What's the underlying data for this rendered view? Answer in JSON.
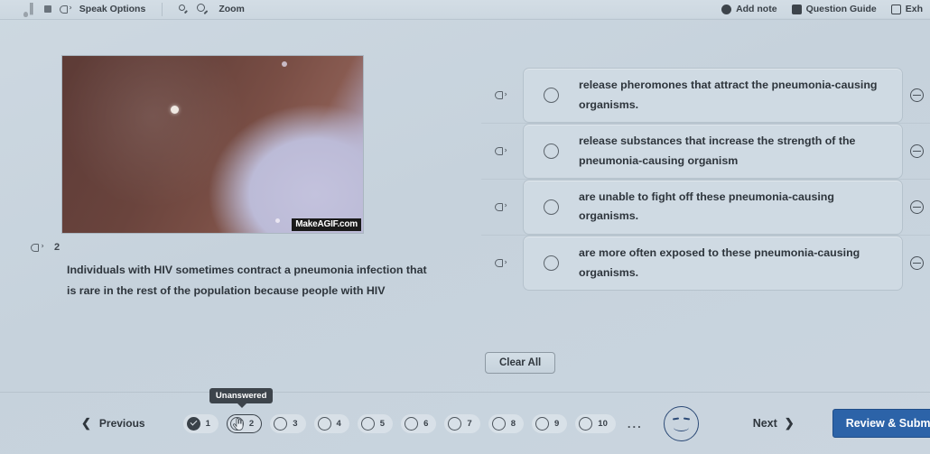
{
  "toolbar": {
    "left_items": [
      {
        "icon": "reader-avatar-icon",
        "label": ""
      },
      {
        "icon": "pause-icon",
        "label": ""
      },
      {
        "icon": "stop-icon",
        "label": ""
      },
      {
        "icon": "speaker-icon",
        "label": "Speak Options"
      }
    ],
    "speak_options_label": "Speak Options",
    "zoom_label": "Zoom",
    "right_items": [
      {
        "icon": "add-note-icon",
        "label": "Add note"
      },
      {
        "icon": "question-guide-icon",
        "label": "Question Guide"
      },
      {
        "icon": "exhibit-icon",
        "label": "Exh"
      }
    ],
    "add_note_label": "Add note",
    "question_guide_label": "Question Guide",
    "exhibit_label": "Exh"
  },
  "stimulus": {
    "watermark": "MakeAGIF.com",
    "alt": "microscopy animation of a pale lavender cell against dark reddish-brown tissue"
  },
  "question": {
    "number": "2",
    "text": "Individuals with HIV sometimes contract a pneumonia infection that is rare in the rest of the population because people with HIV"
  },
  "options": [
    {
      "id": "A",
      "text": "release pheromones that attract the pneumonia-causing organisms.",
      "selected": false
    },
    {
      "id": "B",
      "text": "release substances that increase the strength of the pneumonia-causing organism",
      "selected": false
    },
    {
      "id": "C",
      "text": "are unable to fight off these pneumonia-causing organisms.",
      "selected": false
    },
    {
      "id": "D",
      "text": "are more often exposed to these pneumonia-causing organisms.",
      "selected": false
    }
  ],
  "actions": {
    "clear_all_label": "Clear All"
  },
  "navigation": {
    "previous_label": "Previous",
    "next_label": "Next",
    "submit_label": "Review & Submit",
    "tooltip_label": "Unanswered",
    "ellipsis": "...",
    "items": [
      {
        "number": "1",
        "state": "answered"
      },
      {
        "number": "2",
        "state": "current"
      },
      {
        "number": "3",
        "state": "unanswered"
      },
      {
        "number": "4",
        "state": "unanswered"
      },
      {
        "number": "5",
        "state": "unanswered"
      },
      {
        "number": "6",
        "state": "unanswered"
      },
      {
        "number": "7",
        "state": "unanswered"
      },
      {
        "number": "8",
        "state": "unanswered"
      },
      {
        "number": "9",
        "state": "unanswered"
      },
      {
        "number": "10",
        "state": "unanswered"
      }
    ]
  },
  "colors": {
    "page_bg": "#c8d4de",
    "card_bg": "#cfdae3",
    "submit_blue": "#2a63ab",
    "text": "#2e353c",
    "smiley_blue": "#2b4a78"
  }
}
